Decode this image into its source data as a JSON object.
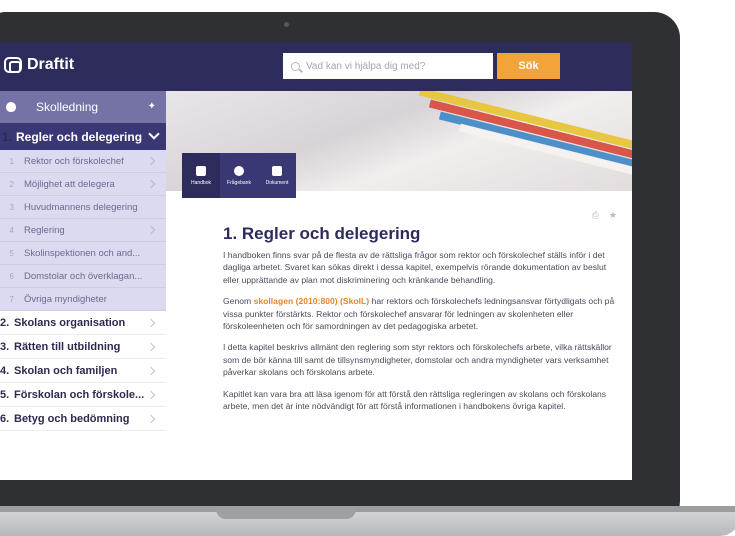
{
  "app": {
    "name": "Draftit"
  },
  "search": {
    "placeholder": "Vad kan vi hjälpa dig med?",
    "button_label": "Sök"
  },
  "sidebar": {
    "header": "Skolledning",
    "active_chapter": {
      "number": "1.",
      "label": "Regler och delegering"
    },
    "subitems": [
      {
        "number": "1",
        "label": "Rektor och förskolechef"
      },
      {
        "number": "2",
        "label": "Möjlighet att delegera"
      },
      {
        "number": "3",
        "label": "Huvudmannens delegering"
      },
      {
        "number": "4",
        "label": "Reglering"
      },
      {
        "number": "5",
        "label": "Skolinspektionen och and..."
      },
      {
        "number": "6",
        "label": "Domstolar och överklagan..."
      },
      {
        "number": "7",
        "label": "Övriga myndigheter"
      }
    ],
    "chapters": [
      {
        "number": "2.",
        "label": "Skolans organisation"
      },
      {
        "number": "3.",
        "label": "Rätten till utbildning"
      },
      {
        "number": "4.",
        "label": "Skolan och familjen"
      },
      {
        "number": "5.",
        "label": "Förskolan och förskole..."
      },
      {
        "number": "6.",
        "label": "Betyg och bedömning"
      }
    ]
  },
  "tabs": [
    {
      "label": "Handbok"
    },
    {
      "label": "Frågebank"
    },
    {
      "label": "Dokument"
    }
  ],
  "article": {
    "title": "1. Regler och delegering",
    "p1": "I handboken finns svar på de flesta av de rättsliga frågor som rektor och förskolechef ställs inför i det dagliga arbetet. Svaret kan sökas direkt i dessa kapitel, exempelvis rörande dokumentation av beslut eller upprättande av plan mot diskriminering och kränkande behandling.",
    "p2_pre": "Genom ",
    "p2_link": "skollagen (2010:800) (SkolL)",
    "p2_post": " har rektors och förskolechefs ledningsansvar förtydligats och på vissa punkter förstärkts. Rektor och förskolechef ansvarar för ledningen av skolenheten eller förskoleenheten och för samordningen av det pedagogiska arbetet.",
    "p3": "I detta kapitel beskrivs allmänt den reglering som styr rektors och förskolechefs arbete, vilka rättskällor som de bör känna till samt de tillsynsmyndigheter, domstolar och andra myndigheter vars verksamhet påverkar skolans och förskolans arbete.",
    "p4": "Kapitlet kan vara bra att läsa igenom för att förstå den rättsliga regleringen av skolans och förskolans arbete, men det är inte nödvändigt för att förstå informationen i handbokens övriga kapitel."
  }
}
